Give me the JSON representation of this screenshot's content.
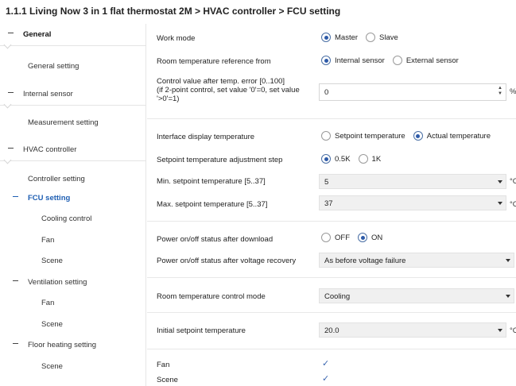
{
  "title": "1.1.1 Living Now 3 in 1 flat thermostat 2M > HVAC controller > FCU setting",
  "sidebar": {
    "items": [
      {
        "label": "General"
      },
      {
        "label": "General setting"
      },
      {
        "label": "Internal sensor"
      },
      {
        "label": "Measurement setting"
      },
      {
        "label": "HVAC controller"
      },
      {
        "label": "Controller setting"
      },
      {
        "label": "FCU setting"
      },
      {
        "label": "Cooling control"
      },
      {
        "label": "Fan"
      },
      {
        "label": "Scene"
      },
      {
        "label": "Ventilation setting"
      },
      {
        "label": "Fan"
      },
      {
        "label": "Scene"
      },
      {
        "label": "Floor heating setting"
      },
      {
        "label": "Scene"
      }
    ]
  },
  "form": {
    "work_mode": {
      "label": "Work mode",
      "opt1": "Master",
      "opt2": "Slave"
    },
    "room_ref": {
      "label": "Room temperature reference from",
      "opt1": "Internal sensor",
      "opt2": "External sensor"
    },
    "control_value": {
      "label1": "Control value after temp. error [0..100]",
      "label2": "(if 2-point control, set value '0'=0, set value",
      "label3": "'>0'=1)",
      "value": "0",
      "unit": "%"
    },
    "display_temp": {
      "label": "Interface display temperature",
      "opt1": "Setpoint temperature",
      "opt2": "Actual temperature"
    },
    "adj_step": {
      "label": "Setpoint temperature adjustment step",
      "opt1": "0.5K",
      "opt2": "1K"
    },
    "min_setpoint": {
      "label": "Min. setpoint temperature [5..37]",
      "value": "5",
      "unit": "°C"
    },
    "max_setpoint": {
      "label": "Max. setpoint temperature [5..37]",
      "value": "37",
      "unit": "°C"
    },
    "power_download": {
      "label": "Power on/off status after download",
      "opt1": "OFF",
      "opt2": "ON"
    },
    "power_recovery": {
      "label": "Power on/off status after voltage recovery",
      "value": "As before voltage failure"
    },
    "control_mode": {
      "label": "Room temperature control mode",
      "value": "Cooling"
    },
    "initial_setpoint": {
      "label": "Initial setpoint temperature",
      "value": "20.0",
      "unit": "°C"
    },
    "fan": {
      "label": "Fan"
    },
    "scene": {
      "label": "Scene"
    }
  }
}
